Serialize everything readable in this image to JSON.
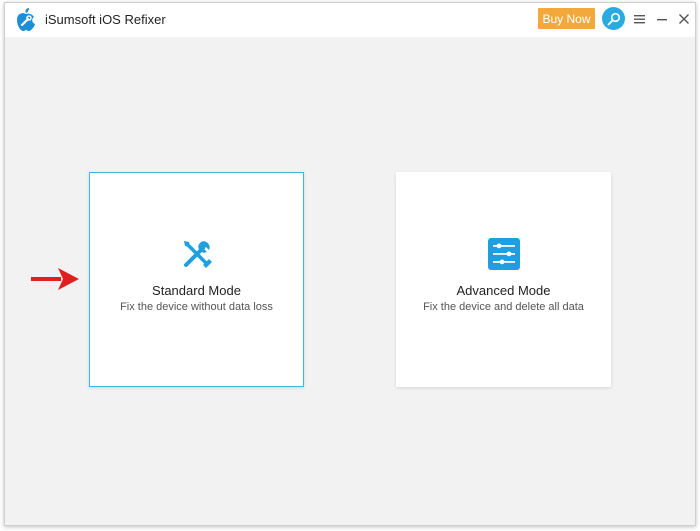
{
  "app": {
    "title": "iSumsoft iOS Refixer",
    "logo_icon": "apple-wrench-logo"
  },
  "header": {
    "buy_label": "Buy Now",
    "buy_color": "#f3a83b",
    "search_icon": "key-search-icon",
    "accent_color": "#29abe2",
    "controls": [
      "menu-icon",
      "minimize-icon",
      "close-icon"
    ]
  },
  "modes": [
    {
      "title": "Standard Mode",
      "description": "Fix the device without data loss",
      "icon": "tools-icon",
      "selected": true
    },
    {
      "title": "Advanced Mode",
      "description": "Fix the device and delete all data",
      "icon": "sliders-icon",
      "selected": false
    }
  ],
  "annotation": {
    "arrow_icon": "red-arrow-icon",
    "arrow_color": "#e02020"
  }
}
